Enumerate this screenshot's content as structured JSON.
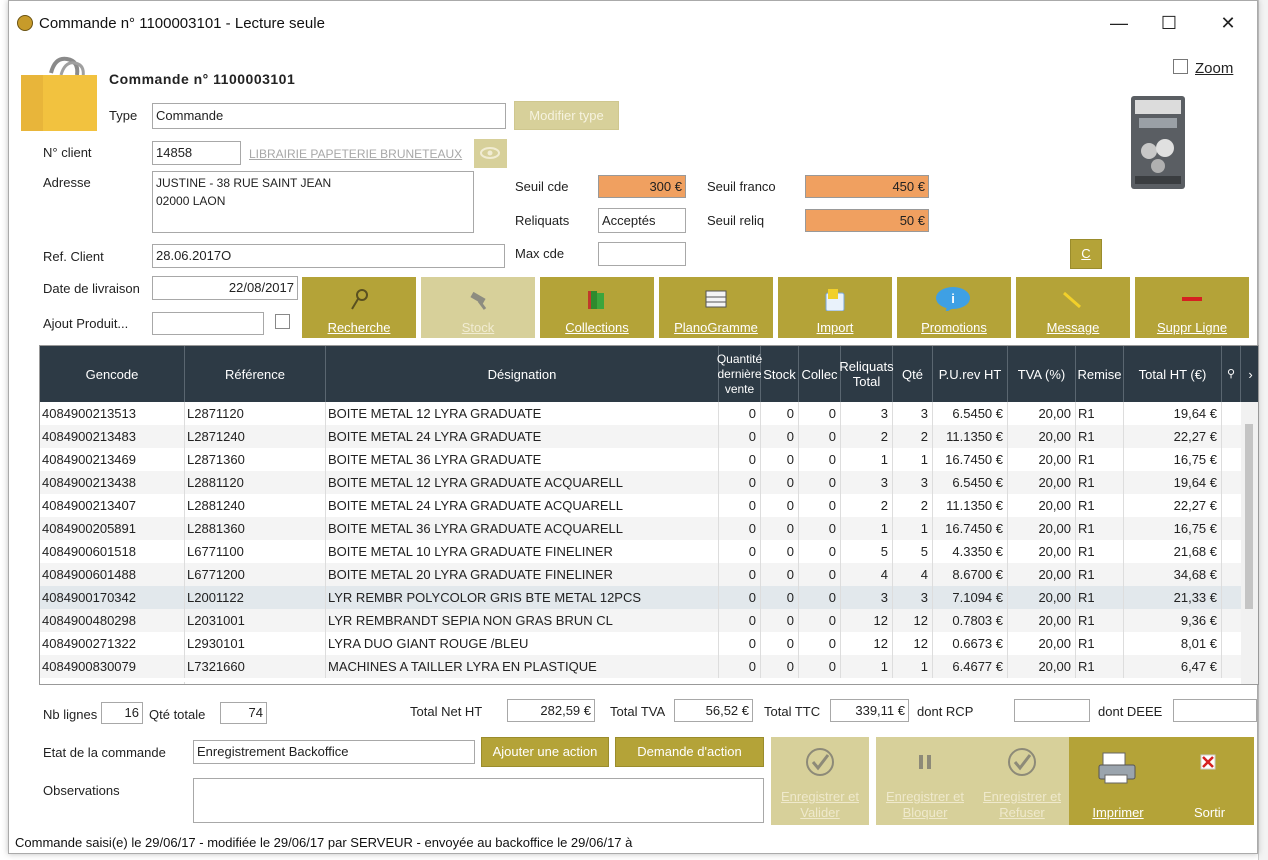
{
  "window": {
    "title": "Commande n° 1100003101 - Lecture seule",
    "min_icon": "minimize-icon",
    "max_icon": "maximize-icon",
    "close_icon": "close-icon"
  },
  "header": {
    "heading": "Commande n° 1100003101",
    "zoom_label": "Zoom"
  },
  "form": {
    "type_label": "Type",
    "type_value": "Commande",
    "modify_type_button": "Modifier type",
    "client_label": "N° client",
    "client_value": "14858",
    "client_link": "LIBRAIRIE PAPETERIE BRUNETEAUX",
    "address_label": "Adresse",
    "address_line1": "JUSTINE - 38 RUE SAINT JEAN",
    "address_line2": "02000 LAON",
    "ref_client_label": "Ref. Client",
    "ref_client_value": "28.06.2017O",
    "delivery_label": "Date de livraison",
    "delivery_value": "22/08/2017",
    "add_product_label": "Ajout Produit...",
    "seuil_cde_label": "Seuil cde",
    "seuil_cde_value": "300 €",
    "reliquats_label": "Reliquats",
    "reliquats_value": "Acceptés",
    "max_cde_label": "Max cde",
    "seuil_franco_label": "Seuil franco",
    "seuil_franco_value": "450 €",
    "seuil_reliq_label": "Seuil reliq",
    "seuil_reliq_value": "50 €",
    "c_button": "C"
  },
  "toolbar": {
    "recherche": "Recherche",
    "stock": "Stock",
    "collections": "Collections",
    "planogramme": "PlanoGramme",
    "import": "Import",
    "promotions": "Promotions",
    "message": "Message",
    "suppr_ligne": "Suppr Ligne"
  },
  "table": {
    "headers": {
      "gencode": "Gencode",
      "reference": "Référence",
      "designation": "Désignation",
      "quantite": "Quantité dernière vente",
      "stock": "Stock",
      "collec": "Collec",
      "reliquats": "Reliquats Total",
      "qte": "Qté",
      "purev": "P.U.rev HT",
      "tva": "TVA (%)",
      "remise": "Remise",
      "total": "Total HT (€)"
    },
    "rows": [
      [
        "4084900213513",
        "L2871120",
        "BOITE METAL 12 LYRA GRADUATE",
        "0",
        "0",
        "0",
        "3",
        "3",
        "6.5450 €",
        "20,00",
        "R1",
        "19,64 €"
      ],
      [
        "4084900213483",
        "L2871240",
        "BOITE METAL 24 LYRA GRADUATE",
        "0",
        "0",
        "0",
        "2",
        "2",
        "11.1350 €",
        "20,00",
        "R1",
        "22,27 €"
      ],
      [
        "4084900213469",
        "L2871360",
        "BOITE METAL 36 LYRA GRADUATE",
        "0",
        "0",
        "0",
        "1",
        "1",
        "16.7450 €",
        "20,00",
        "R1",
        "16,75 €"
      ],
      [
        "4084900213438",
        "L2881120",
        "BOITE METAL 12 LYRA GRADUATE ACQUARELL",
        "0",
        "0",
        "0",
        "3",
        "3",
        "6.5450 €",
        "20,00",
        "R1",
        "19,64 €"
      ],
      [
        "4084900213407",
        "L2881240",
        "BOITE METAL 24 LYRA GRADUATE ACQUARELL",
        "0",
        "0",
        "0",
        "2",
        "2",
        "11.1350 €",
        "20,00",
        "R1",
        "22,27 €"
      ],
      [
        "4084900205891",
        "L2881360",
        "BOITE METAL 36 LYRA GRADUATE ACQUARELL",
        "0",
        "0",
        "0",
        "1",
        "1",
        "16.7450 €",
        "20,00",
        "R1",
        "16,75 €"
      ],
      [
        "4084900601518",
        "L6771100",
        "BOITE METAL 10 LYRA GRADUATE FINELINER",
        "0",
        "0",
        "0",
        "5",
        "5",
        "4.3350 €",
        "20,00",
        "R1",
        "21,68 €"
      ],
      [
        "4084900601488",
        "L6771200",
        "BOITE METAL 20 LYRA GRADUATE FINELINER",
        "0",
        "0",
        "0",
        "4",
        "4",
        "8.6700 €",
        "20,00",
        "R1",
        "34,68 €"
      ],
      [
        "4084900170342",
        "L2001122",
        "LYR REMBR POLYCOLOR GRIS BTE METAL 12PCS",
        "0",
        "0",
        "0",
        "3",
        "3",
        "7.1094 €",
        "20,00",
        "R1",
        "21,33 €"
      ],
      [
        "4084900480298",
        "L2031001",
        "LYR REMBRANDT SEPIA NON GRAS BRUN CL",
        "0",
        "0",
        "0",
        "12",
        "12",
        "0.7803 €",
        "20,00",
        "R1",
        "9,36 €"
      ],
      [
        "4084900271322",
        "L2930101",
        "LYRA  DUO GIANT ROUGE /BLEU",
        "0",
        "0",
        "0",
        "12",
        "12",
        "0.6673 €",
        "20,00",
        "R1",
        "8,01 €"
      ],
      [
        "4084900830079",
        "L7321660",
        "MACHINES A TAILLER LYRA EN PLASTIQUE",
        "0",
        "0",
        "0",
        "1",
        "1",
        "6.4677 €",
        "20,00",
        "R1",
        "6,47 €"
      ]
    ],
    "selected_row": 8
  },
  "totals": {
    "nb_lignes_label": "Nb lignes",
    "nb_lignes_value": "16",
    "qte_totale_label": "Qté totale",
    "qte_totale_value": "74",
    "net_ht_label": "Total Net HT",
    "net_ht_value": "282,59 €",
    "tva_label": "Total TVA",
    "tva_value": "56,52 €",
    "ttc_label": "Total TTC",
    "ttc_value": "339,11 €",
    "rcp_label": "dont RCP",
    "deee_label": "dont DEEE"
  },
  "bottom": {
    "etat_label": "Etat de la commande",
    "etat_value": "Enregistrement Backoffice",
    "add_action": "Ajouter une action",
    "demande_action": "Demande d'action",
    "observations_label": "Observations",
    "btn_valider": "Enregistrer et Valider",
    "btn_bloquer": "Enregistrer et Bloquer",
    "btn_refuser": "Enregistrer et Refuser",
    "btn_imprimer": "Imprimer",
    "btn_sortir": "Sortir"
  },
  "status_text": "Commande saisi(e) le 29/06/17 - modifiée le 29/06/17 par SERVEUR - envoyée au backoffice le 29/06/17 à",
  "colors": {
    "olive": "#b4a338",
    "olive_disabled": "#d7d09a",
    "header_dark": "#2d3a45",
    "orange_field": "#f0a060",
    "bag_yellow": "#f2c23f"
  }
}
